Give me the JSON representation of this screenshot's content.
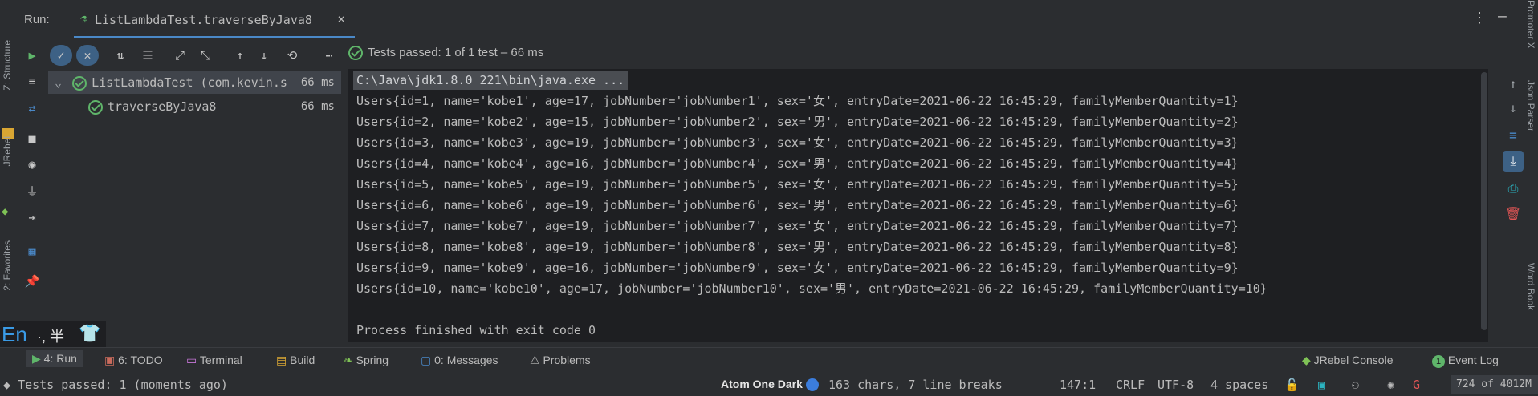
{
  "run": {
    "label": "Run:",
    "tab_title": "ListLambdaTest.traverseByJava8",
    "tab_close": "×",
    "tests_status": "Tests passed: 1 of 1 test – 66 ms"
  },
  "tree": {
    "root": {
      "label": "ListLambdaTest (com.kevin.s",
      "time": "66 ms"
    },
    "child": {
      "label": "traverseByJava8",
      "time": "66 ms"
    }
  },
  "console": {
    "command": "C:\\Java\\jdk1.8.0_221\\bin\\java.exe ...",
    "lines": [
      "Users{id=1, name='kobe1', age=17, jobNumber='jobNumber1', sex='女', entryDate=2021-06-22 16:45:29, familyMemberQuantity=1}",
      "Users{id=2, name='kobe2', age=15, jobNumber='jobNumber2', sex='男', entryDate=2021-06-22 16:45:29, familyMemberQuantity=2}",
      "Users{id=3, name='kobe3', age=19, jobNumber='jobNumber3', sex='女', entryDate=2021-06-22 16:45:29, familyMemberQuantity=3}",
      "Users{id=4, name='kobe4', age=16, jobNumber='jobNumber4', sex='男', entryDate=2021-06-22 16:45:29, familyMemberQuantity=4}",
      "Users{id=5, name='kobe5', age=19, jobNumber='jobNumber5', sex='女', entryDate=2021-06-22 16:45:29, familyMemberQuantity=5}",
      "Users{id=6, name='kobe6', age=19, jobNumber='jobNumber6', sex='男', entryDate=2021-06-22 16:45:29, familyMemberQuantity=6}",
      "Users{id=7, name='kobe7', age=19, jobNumber='jobNumber7', sex='女', entryDate=2021-06-22 16:45:29, familyMemberQuantity=7}",
      "Users{id=8, name='kobe8', age=19, jobNumber='jobNumber8', sex='男', entryDate=2021-06-22 16:45:29, familyMemberQuantity=8}",
      "Users{id=9, name='kobe9', age=16, jobNumber='jobNumber9', sex='女', entryDate=2021-06-22 16:45:29, familyMemberQuantity=9}",
      "Users{id=10, name='kobe10', age=17, jobNumber='jobNumber10', sex='男', entryDate=2021-06-22 16:45:29, familyMemberQuantity=10}"
    ],
    "exit": "Process finished with exit code 0"
  },
  "left_labels": {
    "structure": "Z: Structure",
    "jrebel": "JRebel",
    "favorites": "2: Favorites"
  },
  "right_labels": {
    "promoter": "Promoter X",
    "json_parser": "Json Parser",
    "word_book": "Word Book"
  },
  "ime": {
    "lang": "En",
    "rest": "·, 半"
  },
  "bottom_tabs": [
    {
      "label": "4: Run"
    },
    {
      "label": "6: TODO"
    },
    {
      "label": "Terminal"
    },
    {
      "label": "Build"
    },
    {
      "label": "Spring"
    },
    {
      "label": "0: Messages"
    },
    {
      "label": "Problems"
    },
    {
      "label": "JRebel Console"
    },
    {
      "label": "Event Log"
    }
  ],
  "event_log_count": "1",
  "status": {
    "message": "Tests passed: 1 (moments ago)",
    "theme": "Atom One Dark",
    "selection": "163 chars, 7 line breaks",
    "position": "147:1",
    "line_sep": "CRLF",
    "encoding": "UTF-8",
    "indent": "4 spaces",
    "memory": "724 of 4012M"
  },
  "colors": {
    "accent": "#4a88c7",
    "success": "#5fb56a",
    "console_bg": "#1e1f22"
  }
}
